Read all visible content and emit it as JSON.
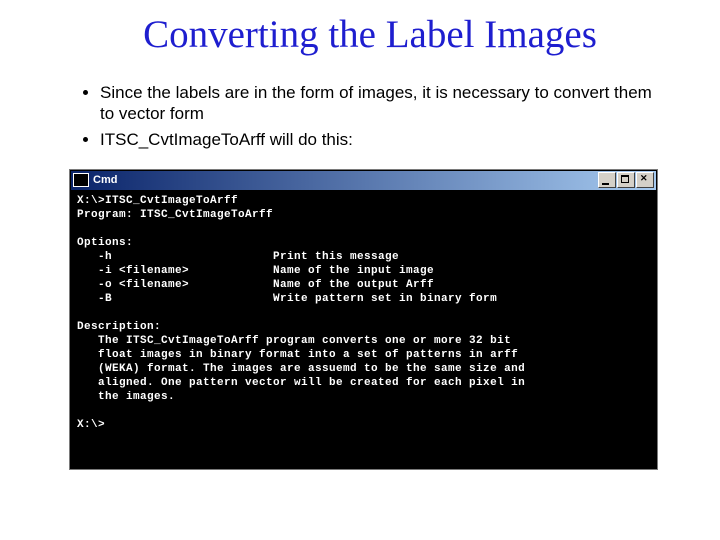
{
  "slide": {
    "title": "Converting the Label Images",
    "bullets": [
      "Since the labels are in the form of images, it is necessary to convert them to vector form",
      "ITSC_CvtImageToArff will do this:"
    ]
  },
  "cmd": {
    "title": "Cmd",
    "lines": [
      "X:\\>ITSC_CvtImageToArff",
      "Program: ITSC_CvtImageToArff",
      "",
      "Options:",
      "   -h                       Print this message",
      "   -i <filename>            Name of the input image",
      "   -o <filename>            Name of the output Arff",
      "   -B                       Write pattern set in binary form",
      "",
      "Description:",
      "   The ITSC_CvtImageToArff program converts one or more 32 bit",
      "   float images in binary format into a set of patterns in arff",
      "   (WEKA) format. The images are assuemd to be the same size and",
      "   aligned. One pattern vector will be created for each pixel in",
      "   the images.",
      "",
      "X:\\>"
    ]
  }
}
